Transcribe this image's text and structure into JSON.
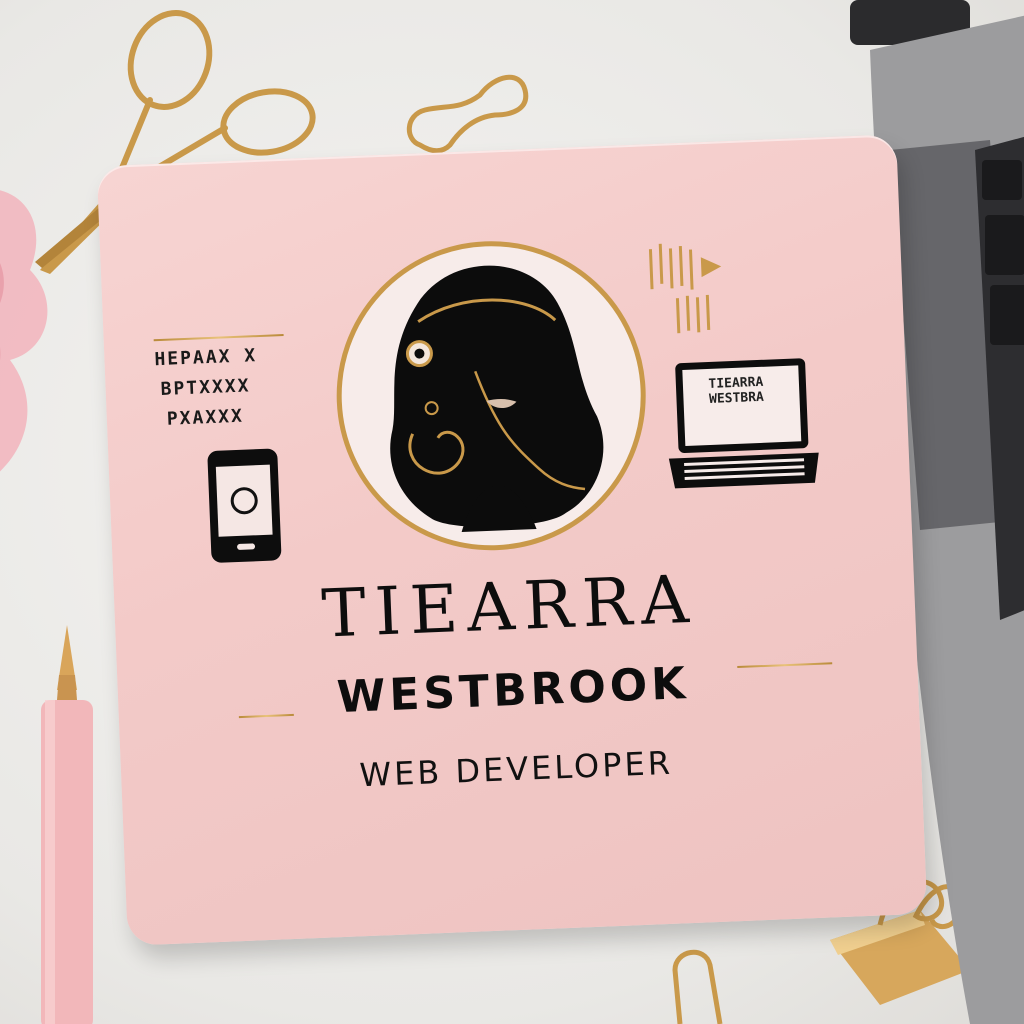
{
  "card": {
    "name_first": "TIEARRA",
    "name_last": "WESTBROOK",
    "role": "WEB DEVELOPER",
    "side_text": [
      "HEPAAX X",
      "BPTXXXX",
      "PXAXXX"
    ],
    "laptop_caption": [
      "TIEARRA",
      "WESTBRA"
    ]
  },
  "colors": {
    "card_pink": "#f3cac8",
    "gold": "#c9994a",
    "ink": "#0d0d0d",
    "desk": "#ecebe8"
  },
  "icons": [
    "scissors-icon",
    "paperclip-icon",
    "binder-clip-icon",
    "pen-icon",
    "smartphone-icon",
    "laptop-icon",
    "portrait-emblem"
  ]
}
